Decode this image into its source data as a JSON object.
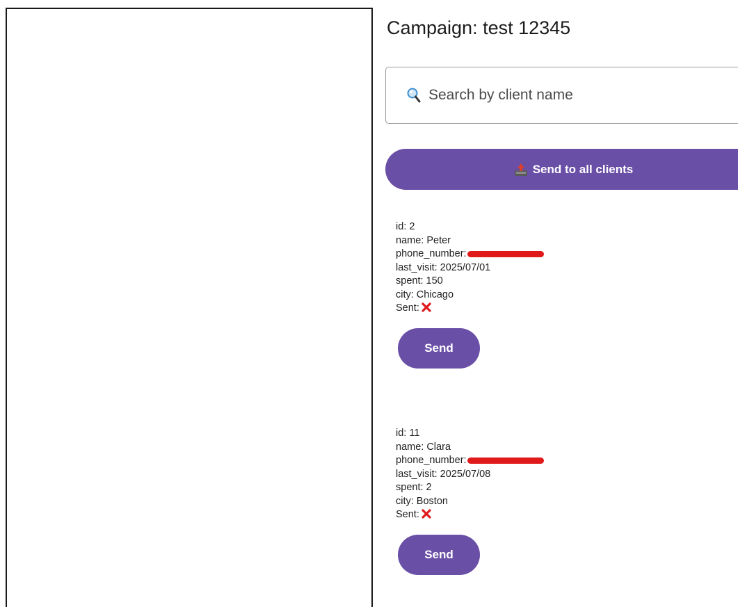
{
  "campaign": {
    "title": "Campaign: test 12345"
  },
  "search": {
    "placeholder": "Search by client name"
  },
  "send_all": {
    "label": "Send to all clients"
  },
  "clients": [
    {
      "id": "id: 2",
      "name": "name: Peter",
      "phone_label": "phone_number:",
      "last_visit": "last_visit: 2025/07/01",
      "spent": "spent: 150",
      "city": "city: Chicago",
      "sent_label": "Sent:",
      "send_label": "Send"
    },
    {
      "id": "id: 11",
      "name": "name: Clara",
      "phone_label": "phone_number:",
      "last_visit": "last_visit: 2025/07/08",
      "spent": "spent: 2",
      "city": "city: Boston",
      "sent_label": "Sent:",
      "send_label": "Send"
    }
  ],
  "colors": {
    "accent": "#6a4fa7",
    "redaction": "#e0191b",
    "sent_no": "#e0191b"
  }
}
